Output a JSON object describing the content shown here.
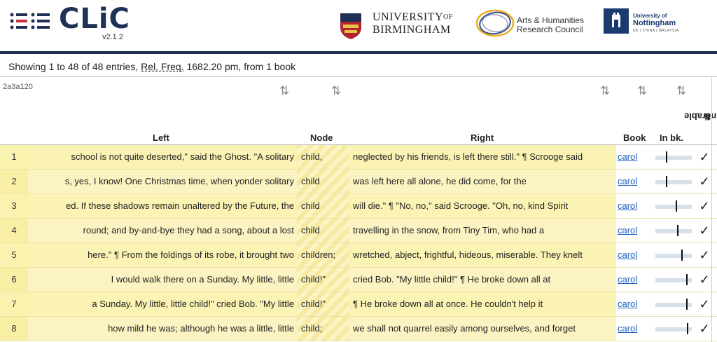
{
  "app": {
    "name": "CLiC",
    "version": "v2.1.2"
  },
  "partners": {
    "birmingham": {
      "line1": "UNIVERSITY",
      "of": "OF",
      "line2": "BIRMINGHAM"
    },
    "ahrc": {
      "line1": "Arts & Humanities",
      "line2": "Research Council"
    },
    "nottingham": {
      "line1": "University of",
      "line2": "Nottingham",
      "line3": "UK | CHINA | MALAYSIA"
    }
  },
  "summary": {
    "prefix": "Showing 1 to 48 of 48 entries, ",
    "abbr": "Rel. Freq.",
    "suffix": " 1682.20 pm, from 1 book"
  },
  "table": {
    "hash": "2a3a120",
    "columns": {
      "left": "Left",
      "node": "Node",
      "right": "Right",
      "book": "Book",
      "inbk": "In bk.",
      "vulnerable": "Vulnerable"
    },
    "sort_glyph": "⇅",
    "vulnerable_glyph": "⇅",
    "rows": [
      {
        "n": "1",
        "left": "school is not quite deserted,\" said the Ghost. \"A solitary",
        "node": "child,",
        "right": "neglected by his friends, is left there still.\" ¶ Scrooge said",
        "book": "carol",
        "pos": 0.3,
        "tick": "✓"
      },
      {
        "n": "2",
        "left": "s, yes, I know! One Christmas time, when yonder solitary",
        "node": "child",
        "right": "was left here all alone, he did come, for the",
        "book": "carol",
        "pos": 0.3,
        "tick": "✓"
      },
      {
        "n": "3",
        "left": "ed. If these shadows remain unaltered by the Future, the",
        "node": "child",
        "right": "will die.\" ¶ \"No, no,\" said Scrooge. \"Oh, no, kind Spirit",
        "book": "carol",
        "pos": 0.58,
        "tick": "✓"
      },
      {
        "n": "4",
        "left": "round; and by-and-bye they had a song, about a lost",
        "node": "child",
        "right": "travelling in the snow, from Tiny Tim, who had a",
        "book": "carol",
        "pos": 0.62,
        "tick": "✓"
      },
      {
        "n": "5",
        "left": "here.\" ¶ From the foldings of its robe, it brought two",
        "node": "children;",
        "right": "wretched, abject, frightful, hideous, miserable. They knelt",
        "book": "carol",
        "pos": 0.73,
        "tick": "✓"
      },
      {
        "n": "6",
        "left": "I would walk there on a Sunday. My little, little",
        "node": "child!\"",
        "right": "cried Bob. \"My little child!\" ¶ He broke down all at",
        "book": "carol",
        "pos": 0.88,
        "tick": "✓"
      },
      {
        "n": "7",
        "left": "a Sunday. My little, little child!\" cried Bob. \"My little",
        "node": "child!\"",
        "right": "¶ He broke down all at once. He couldn't help it",
        "book": "carol",
        "pos": 0.88,
        "tick": "✓"
      },
      {
        "n": "8",
        "left": "how mild he was; although he was a little, little",
        "node": "child;",
        "right": "we shall not quarrel easily among ourselves, and forget",
        "book": "carol",
        "pos": 0.9,
        "tick": "✓"
      }
    ]
  }
}
